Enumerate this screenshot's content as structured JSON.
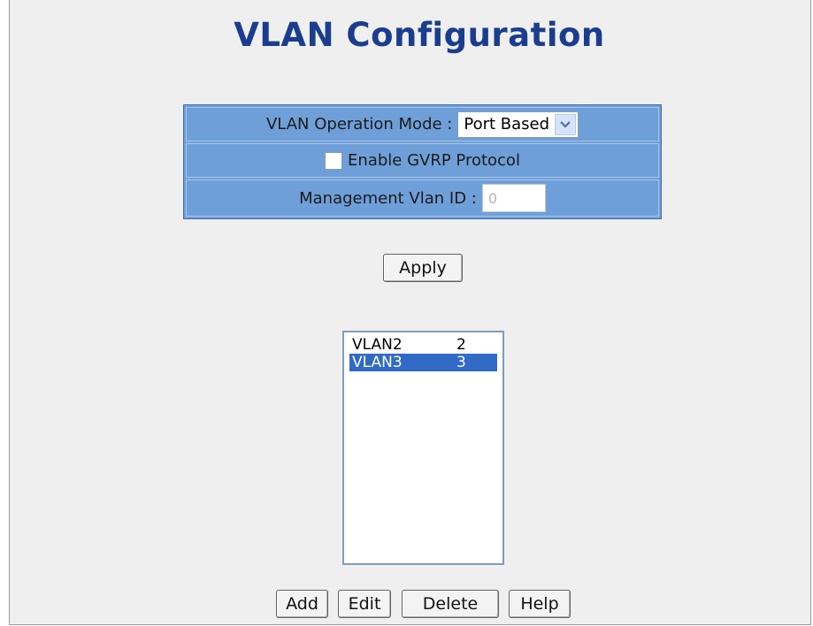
{
  "page": {
    "title": "VLAN Configuration"
  },
  "config": {
    "operation_mode_label": "VLAN Operation Mode :",
    "operation_mode_value": "Port Based",
    "gvrp_label": "Enable GVRP Protocol",
    "gvrp_checked": false,
    "mgmt_vlan_label": "Management Vlan ID :",
    "mgmt_vlan_value": "0"
  },
  "apply_label": "Apply",
  "vlan_list": {
    "items": [
      {
        "name": "VLAN2",
        "id": "2",
        "selected": false
      },
      {
        "name": "VLAN3",
        "id": "3",
        "selected": true
      }
    ]
  },
  "actions": {
    "add_label": "Add",
    "edit_label": "Edit",
    "delete_label": "Delete",
    "help_label": "Help"
  },
  "colors": {
    "title": "#1a3d8f",
    "table_bg": "#6f9fd8",
    "selection": "#316ac5"
  },
  "icons": {
    "dropdown": "chevron-down-icon",
    "checkbox": "checkbox-icon"
  }
}
